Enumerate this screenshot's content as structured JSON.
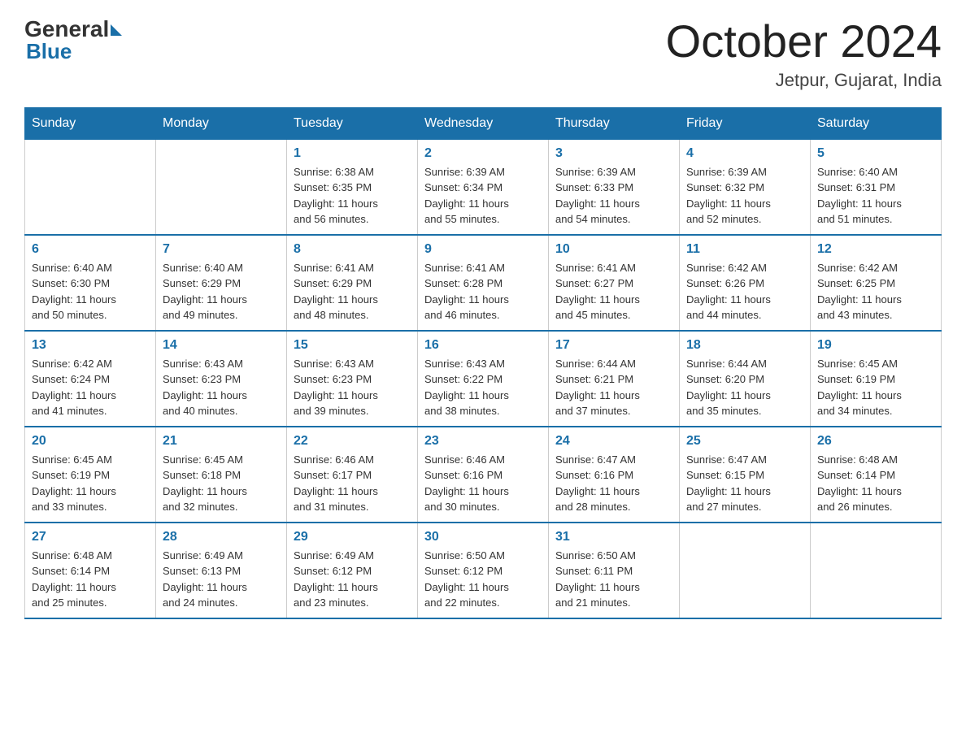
{
  "header": {
    "logo_general": "General",
    "logo_blue": "Blue",
    "main_title": "October 2024",
    "subtitle": "Jetpur, Gujarat, India"
  },
  "days_of_week": [
    "Sunday",
    "Monday",
    "Tuesday",
    "Wednesday",
    "Thursday",
    "Friday",
    "Saturday"
  ],
  "weeks": [
    [
      {
        "day": "",
        "info": ""
      },
      {
        "day": "",
        "info": ""
      },
      {
        "day": "1",
        "info": "Sunrise: 6:38 AM\nSunset: 6:35 PM\nDaylight: 11 hours\nand 56 minutes."
      },
      {
        "day": "2",
        "info": "Sunrise: 6:39 AM\nSunset: 6:34 PM\nDaylight: 11 hours\nand 55 minutes."
      },
      {
        "day": "3",
        "info": "Sunrise: 6:39 AM\nSunset: 6:33 PM\nDaylight: 11 hours\nand 54 minutes."
      },
      {
        "day": "4",
        "info": "Sunrise: 6:39 AM\nSunset: 6:32 PM\nDaylight: 11 hours\nand 52 minutes."
      },
      {
        "day": "5",
        "info": "Sunrise: 6:40 AM\nSunset: 6:31 PM\nDaylight: 11 hours\nand 51 minutes."
      }
    ],
    [
      {
        "day": "6",
        "info": "Sunrise: 6:40 AM\nSunset: 6:30 PM\nDaylight: 11 hours\nand 50 minutes."
      },
      {
        "day": "7",
        "info": "Sunrise: 6:40 AM\nSunset: 6:29 PM\nDaylight: 11 hours\nand 49 minutes."
      },
      {
        "day": "8",
        "info": "Sunrise: 6:41 AM\nSunset: 6:29 PM\nDaylight: 11 hours\nand 48 minutes."
      },
      {
        "day": "9",
        "info": "Sunrise: 6:41 AM\nSunset: 6:28 PM\nDaylight: 11 hours\nand 46 minutes."
      },
      {
        "day": "10",
        "info": "Sunrise: 6:41 AM\nSunset: 6:27 PM\nDaylight: 11 hours\nand 45 minutes."
      },
      {
        "day": "11",
        "info": "Sunrise: 6:42 AM\nSunset: 6:26 PM\nDaylight: 11 hours\nand 44 minutes."
      },
      {
        "day": "12",
        "info": "Sunrise: 6:42 AM\nSunset: 6:25 PM\nDaylight: 11 hours\nand 43 minutes."
      }
    ],
    [
      {
        "day": "13",
        "info": "Sunrise: 6:42 AM\nSunset: 6:24 PM\nDaylight: 11 hours\nand 41 minutes."
      },
      {
        "day": "14",
        "info": "Sunrise: 6:43 AM\nSunset: 6:23 PM\nDaylight: 11 hours\nand 40 minutes."
      },
      {
        "day": "15",
        "info": "Sunrise: 6:43 AM\nSunset: 6:23 PM\nDaylight: 11 hours\nand 39 minutes."
      },
      {
        "day": "16",
        "info": "Sunrise: 6:43 AM\nSunset: 6:22 PM\nDaylight: 11 hours\nand 38 minutes."
      },
      {
        "day": "17",
        "info": "Sunrise: 6:44 AM\nSunset: 6:21 PM\nDaylight: 11 hours\nand 37 minutes."
      },
      {
        "day": "18",
        "info": "Sunrise: 6:44 AM\nSunset: 6:20 PM\nDaylight: 11 hours\nand 35 minutes."
      },
      {
        "day": "19",
        "info": "Sunrise: 6:45 AM\nSunset: 6:19 PM\nDaylight: 11 hours\nand 34 minutes."
      }
    ],
    [
      {
        "day": "20",
        "info": "Sunrise: 6:45 AM\nSunset: 6:19 PM\nDaylight: 11 hours\nand 33 minutes."
      },
      {
        "day": "21",
        "info": "Sunrise: 6:45 AM\nSunset: 6:18 PM\nDaylight: 11 hours\nand 32 minutes."
      },
      {
        "day": "22",
        "info": "Sunrise: 6:46 AM\nSunset: 6:17 PM\nDaylight: 11 hours\nand 31 minutes."
      },
      {
        "day": "23",
        "info": "Sunrise: 6:46 AM\nSunset: 6:16 PM\nDaylight: 11 hours\nand 30 minutes."
      },
      {
        "day": "24",
        "info": "Sunrise: 6:47 AM\nSunset: 6:16 PM\nDaylight: 11 hours\nand 28 minutes."
      },
      {
        "day": "25",
        "info": "Sunrise: 6:47 AM\nSunset: 6:15 PM\nDaylight: 11 hours\nand 27 minutes."
      },
      {
        "day": "26",
        "info": "Sunrise: 6:48 AM\nSunset: 6:14 PM\nDaylight: 11 hours\nand 26 minutes."
      }
    ],
    [
      {
        "day": "27",
        "info": "Sunrise: 6:48 AM\nSunset: 6:14 PM\nDaylight: 11 hours\nand 25 minutes."
      },
      {
        "day": "28",
        "info": "Sunrise: 6:49 AM\nSunset: 6:13 PM\nDaylight: 11 hours\nand 24 minutes."
      },
      {
        "day": "29",
        "info": "Sunrise: 6:49 AM\nSunset: 6:12 PM\nDaylight: 11 hours\nand 23 minutes."
      },
      {
        "day": "30",
        "info": "Sunrise: 6:50 AM\nSunset: 6:12 PM\nDaylight: 11 hours\nand 22 minutes."
      },
      {
        "day": "31",
        "info": "Sunrise: 6:50 AM\nSunset: 6:11 PM\nDaylight: 11 hours\nand 21 minutes."
      },
      {
        "day": "",
        "info": ""
      },
      {
        "day": "",
        "info": ""
      }
    ]
  ]
}
